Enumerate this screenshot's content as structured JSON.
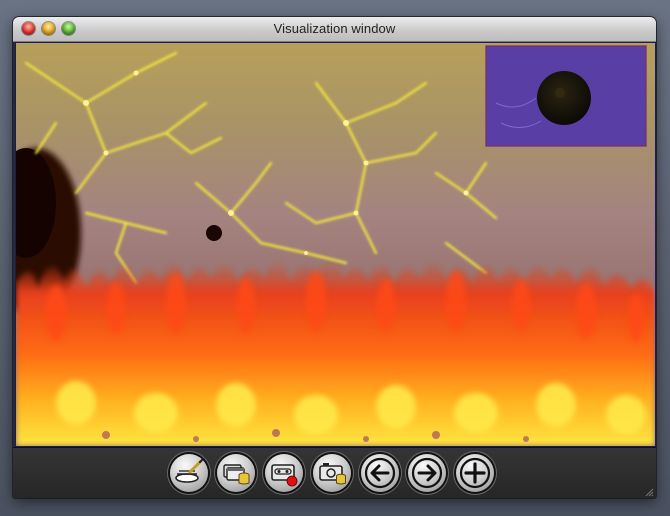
{
  "window": {
    "title": "Visualization window",
    "traffic_lights": {
      "close": {
        "icon": "close-light-icon",
        "color": "#e0362c"
      },
      "minimize": {
        "icon": "minimize-light-icon",
        "color": "#e7a51c"
      },
      "zoom": {
        "icon": "zoom-light-icon",
        "color": "#58b431"
      }
    }
  },
  "visualization": {
    "content": "Mandelbrot fractal with fire effect",
    "colors": {
      "fractal": "#f2e83a",
      "fire": "#ff5a12",
      "fire_core": "#ffe84a",
      "background": "#a88a70"
    },
    "thumbnail": {
      "background": "#6a4ab8",
      "blob": "#1a160c",
      "border": "#8a3a6a"
    }
  },
  "toolbar": {
    "buttons": [
      {
        "name": "settings-button",
        "icon": "brush-plate-icon"
      },
      {
        "name": "save-windows-button",
        "icon": "windows-database-icon"
      },
      {
        "name": "record-button",
        "icon": "recorder-record-icon"
      },
      {
        "name": "snapshot-button",
        "icon": "camera-database-icon"
      },
      {
        "name": "previous-button",
        "icon": "arrow-left-icon"
      },
      {
        "name": "next-button",
        "icon": "arrow-right-icon"
      },
      {
        "name": "add-button",
        "icon": "plus-icon"
      }
    ]
  }
}
